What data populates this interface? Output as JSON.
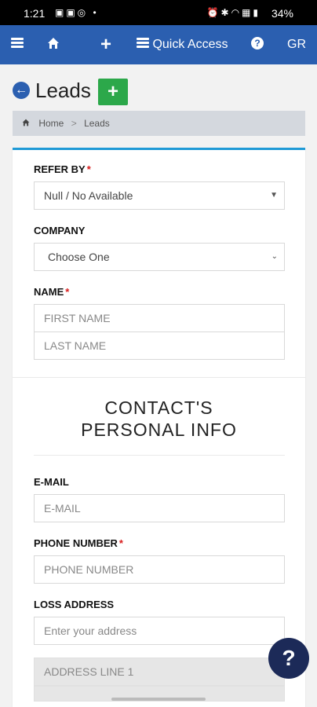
{
  "status_bar": {
    "time": "1:21",
    "battery": "34%"
  },
  "nav": {
    "quick_access_label": "Quick Access",
    "user_initials": "GR"
  },
  "page": {
    "title": "Leads"
  },
  "breadcrumb": {
    "home": "Home",
    "current": "Leads"
  },
  "form": {
    "refer_by": {
      "label": "REFER BY",
      "value": "Null / No Available"
    },
    "company": {
      "label": "COMPANY",
      "value": "Choose One"
    },
    "name": {
      "label": "NAME",
      "first_placeholder": "FIRST NAME",
      "last_placeholder": "LAST NAME"
    },
    "section_contact": "CONTACT'S PERSONAL INFO",
    "email": {
      "label": "E-MAIL",
      "placeholder": "E-MAIL"
    },
    "phone": {
      "label": "PHONE NUMBER",
      "placeholder": "PHONE NUMBER"
    },
    "loss_address": {
      "label": "LOSS ADDRESS",
      "placeholder": "Enter your address",
      "line1_placeholder": "ADDRESS LINE 1"
    }
  },
  "help": {
    "label": "?"
  },
  "icons": {
    "back": "arrow-left-circle-icon",
    "menu": "bars-icon",
    "home": "home-icon",
    "add": "plus-icon",
    "quick": "list-icon",
    "help": "question-circle-icon"
  },
  "colors": {
    "nav_bg": "#2b5fb0",
    "add_button": "#2ca84a",
    "card_accent": "#1f9ad6",
    "required": "#d81b1b",
    "fab": "#1c2a58"
  }
}
